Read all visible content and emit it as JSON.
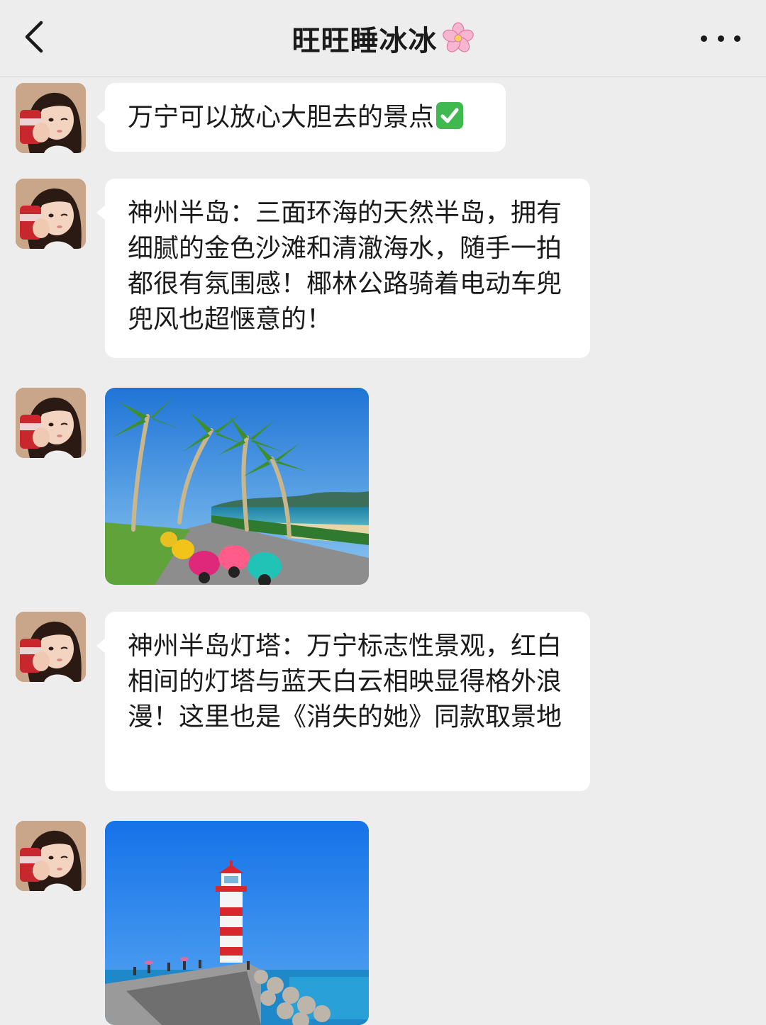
{
  "header": {
    "title": "旺旺睡冰冰",
    "back_icon": "chevron-left-icon",
    "title_icon": "cherry-blossom-icon",
    "more_icon": "more-dots-icon"
  },
  "messages": [
    {
      "type": "text",
      "text": "万宁可以放心大胆去的景点",
      "trailing_icon": "check-mark-button-icon"
    },
    {
      "type": "text",
      "text": "神州半岛：三面环海的天然半岛，拥有细腻的金色沙滩和清澈海水，随手一拍都很有氛围感！椰林公路骑着电动车兜兜风也超惬意的！"
    },
    {
      "type": "image",
      "description_icon": "beach-road-palm-trees-scooters-photo"
    },
    {
      "type": "text",
      "text": "神州半岛灯塔：万宁标志性景观，红白相间的灯塔与蓝天白云相映显得格外浪漫！这里也是《消失的她》同款取景地"
    },
    {
      "type": "image",
      "description_icon": "red-white-lighthouse-breakwater-photo"
    }
  ],
  "colors": {
    "background": "#ededed",
    "bubble": "#ffffff",
    "text": "#1a1a1a",
    "check_green": "#3fb950"
  }
}
